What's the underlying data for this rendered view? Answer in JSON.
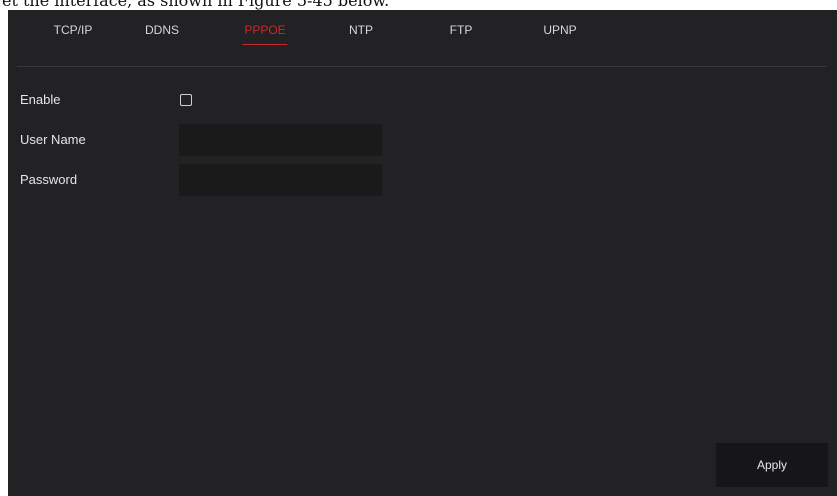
{
  "caption": "et the interface, as shown in Figure 5-45 below.",
  "tabs": [
    {
      "label": "TCP/IP",
      "active": false
    },
    {
      "label": "DDNS",
      "active": false
    },
    {
      "label": "PPPOE",
      "active": true
    },
    {
      "label": "NTP",
      "active": false
    },
    {
      "label": "FTP",
      "active": false
    },
    {
      "label": "UPNP",
      "active": false
    }
  ],
  "form": {
    "enable_label": "Enable",
    "enable_checked": false,
    "username_label": "User Name",
    "username_value": "",
    "password_label": "Password",
    "password_value": ""
  },
  "apply_label": "Apply",
  "colors": {
    "background": "#222225",
    "active_tab": "#c8282a",
    "input_bg": "#1a1a1a"
  }
}
